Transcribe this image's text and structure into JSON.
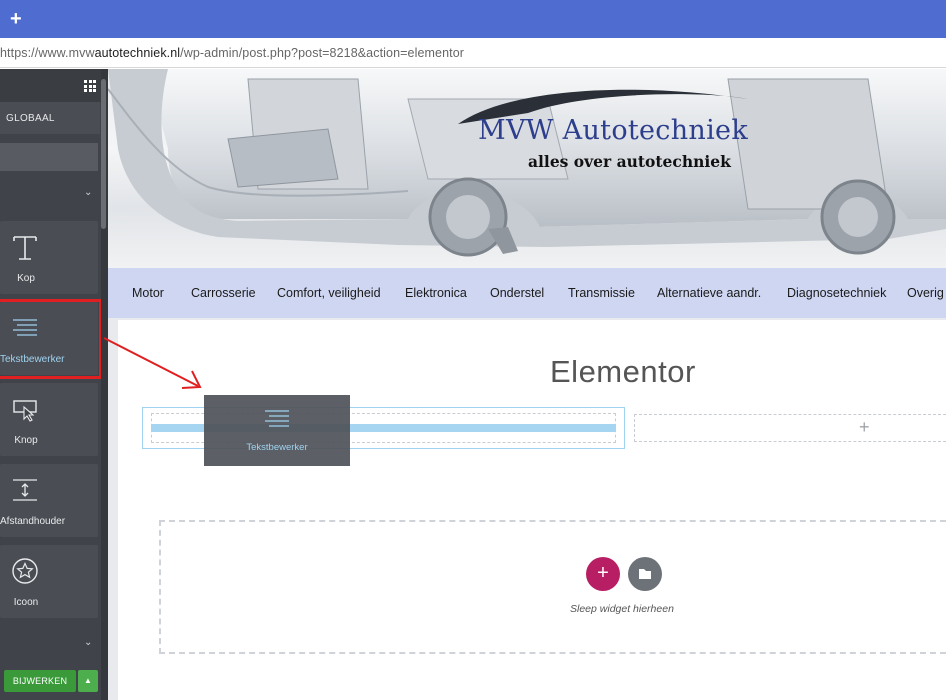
{
  "browser": {
    "new_tab": "+",
    "url_prefix": "https://www.mvw",
    "url_domain": "autotechniek.nl",
    "url_path": "/wp-admin/post.php?post=8218&action=elementor"
  },
  "panel": {
    "tab_label": "GLOBAAL",
    "widgets": [
      {
        "label": "Kop",
        "icon": "heading-icon"
      },
      {
        "label": "Tekstbewerker",
        "icon": "text-editor-icon"
      },
      {
        "label": "Knop",
        "icon": "button-icon"
      },
      {
        "label": "Afstandhouder",
        "icon": "spacer-icon"
      },
      {
        "label": "Icoon",
        "icon": "star-icon"
      }
    ],
    "update_label": "BIJWERKEN",
    "update_caret": "▲"
  },
  "site": {
    "logo_title": "MVW Autotechniek",
    "logo_subtitle": "alles over autotechniek",
    "nav": [
      "Motor",
      "Carrosserie",
      "Comfort, veiligheid",
      "Elektronica",
      "Onderstel",
      "Transmissie",
      "Alternatieve aandr.",
      "Diagnosetechniek",
      "Overig"
    ]
  },
  "editor": {
    "page_title": "Elementor",
    "drag_widget_label": "Tekstbewerker",
    "column_plus": "+",
    "add_section": "+",
    "drop_hint": "Sleep widget hierheen"
  },
  "colors": {
    "tab_bar": "#4f6cd0",
    "panel": "#404349",
    "highlight": "#e02020",
    "nav_bg": "#cfd6f2",
    "accent_blue": "#9fd3f0",
    "add_button": "#b81e64",
    "update_button": "#3a9a3a"
  }
}
